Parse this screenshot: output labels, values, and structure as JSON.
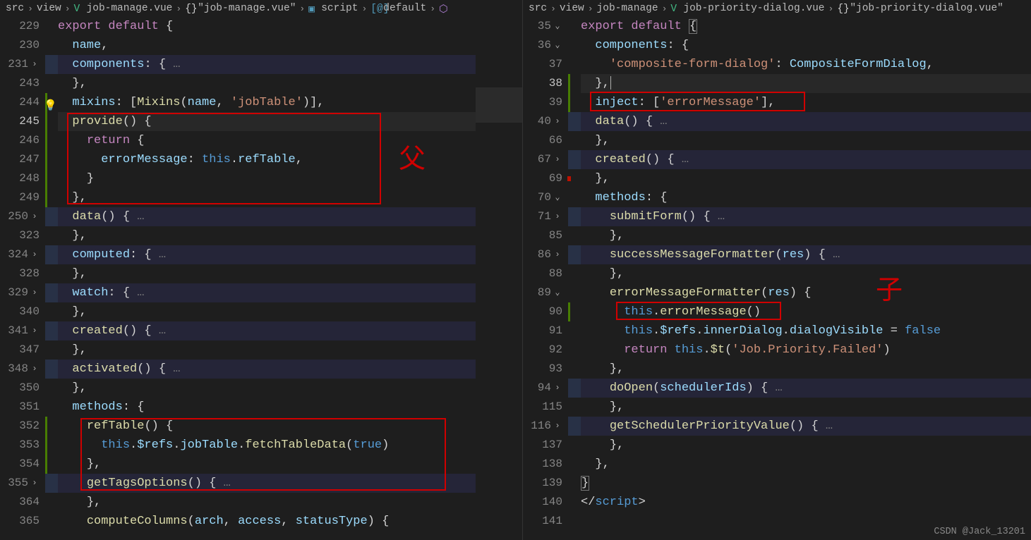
{
  "watermark": "CSDN @Jack_13201",
  "annotations": {
    "left_char": "父",
    "right_char": "子"
  },
  "left": {
    "breadcrumbs": [
      "src",
      "view",
      "job-manage.vue",
      "\"job-manage.vue\"",
      "script",
      "default"
    ],
    "lines": {
      "229": {
        "num": "229"
      },
      "230": {
        "num": "230"
      },
      "231": {
        "num": "231"
      },
      "243": {
        "num": "243"
      },
      "244": {
        "num": "244"
      },
      "245": {
        "num": "245"
      },
      "246": {
        "num": "246"
      },
      "247": {
        "num": "247"
      },
      "248": {
        "num": "248"
      },
      "249": {
        "num": "249"
      },
      "250": {
        "num": "250"
      },
      "323": {
        "num": "323"
      },
      "324": {
        "num": "324"
      },
      "328": {
        "num": "328"
      },
      "329": {
        "num": "329"
      },
      "340": {
        "num": "340"
      },
      "341": {
        "num": "341"
      },
      "347": {
        "num": "347"
      },
      "348": {
        "num": "348"
      },
      "350": {
        "num": "350"
      },
      "351": {
        "num": "351"
      },
      "352": {
        "num": "352"
      },
      "353": {
        "num": "353"
      },
      "354": {
        "num": "354"
      },
      "355": {
        "num": "355"
      },
      "364": {
        "num": "364"
      },
      "365": {
        "num": "365"
      }
    },
    "tokens": {
      "export": "export",
      "default": "default",
      "name": "name",
      "components": "components",
      "mixins": "mixins",
      "Mixins": "Mixins",
      "jobTable": "'jobTable'",
      "provide": "provide",
      "return": "return",
      "errorMessage": "errorMessage",
      "this": "this",
      "refTable": "refTable",
      "data": "data",
      "computed": "computed",
      "watch": "watch",
      "created": "created",
      "activated": "activated",
      "methods": "methods",
      "refTableFn": "refTable",
      "refs": "$refs",
      "jobTableP": "jobTable",
      "fetchTableData": "fetchTableData",
      "true": "true",
      "getTagsOptions": "getTagsOptions",
      "computeColumns": "computeColumns",
      "arch": "arch",
      "access": "access",
      "statusType": "statusType"
    }
  },
  "right": {
    "breadcrumbs": [
      "src",
      "view",
      "job-manage",
      "job-priority-dialog.vue",
      "\"job-priority-dialog.vue\""
    ],
    "lines": {
      "35": {
        "num": "35"
      },
      "36": {
        "num": "36"
      },
      "37": {
        "num": "37"
      },
      "38": {
        "num": "38"
      },
      "39": {
        "num": "39"
      },
      "40": {
        "num": "40"
      },
      "66": {
        "num": "66"
      },
      "67": {
        "num": "67"
      },
      "69": {
        "num": "69"
      },
      "70": {
        "num": "70"
      },
      "71": {
        "num": "71"
      },
      "85": {
        "num": "85"
      },
      "86": {
        "num": "86"
      },
      "88": {
        "num": "88"
      },
      "89": {
        "num": "89"
      },
      "90": {
        "num": "90"
      },
      "91": {
        "num": "91"
      },
      "92": {
        "num": "92"
      },
      "93": {
        "num": "93"
      },
      "94": {
        "num": "94"
      },
      "115": {
        "num": "115"
      },
      "116": {
        "num": "116"
      },
      "137": {
        "num": "137"
      },
      "138": {
        "num": "138"
      },
      "139": {
        "num": "139"
      },
      "140": {
        "num": "140"
      },
      "141": {
        "num": "141"
      }
    },
    "tokens": {
      "export": "export",
      "default": "default",
      "components": "components",
      "cfd_key": "'composite-form-dialog'",
      "CompositeFormDialog": "CompositeFormDialog",
      "inject": "inject",
      "errorMessageStr": "'errorMessage'",
      "data": "data",
      "created": "created",
      "methods": "methods",
      "submitForm": "submitForm",
      "successMessageFormatter": "successMessageFormatter",
      "res": "res",
      "errorMessageFormatter": "errorMessageFormatter",
      "this": "this",
      "errorMessage": "errorMessage",
      "refs": "$refs",
      "innerDialog": "innerDialog",
      "dialogVisible": "dialogVisible",
      "false": "false",
      "return": "return",
      "t": "$t",
      "jobPriorityFailed": "'Job.Priority.Failed'",
      "doOpen": "doOpen",
      "schedulerIds": "schedulerIds",
      "getSchedulerPriorityValue": "getSchedulerPriorityValue",
      "script": "script"
    }
  }
}
